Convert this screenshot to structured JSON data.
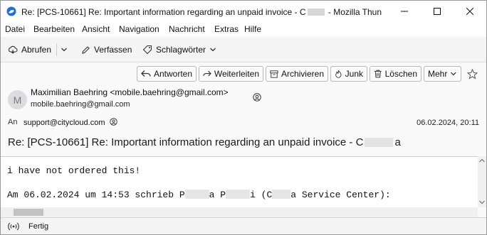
{
  "window": {
    "title_prefix": "Re: [PCS-10661] Re: Important information regarding an unpaid invoice - C",
    "title_suffix": " - Mozilla Thun"
  },
  "menubar": {
    "items": [
      "Datei",
      "Bearbeiten",
      "Ansicht",
      "Navigation",
      "Nachricht",
      "Extras",
      "Hilfe"
    ]
  },
  "toolbar": {
    "get_messages": "Abrufen",
    "compose": "Verfassen",
    "tags": "Schlagwörter"
  },
  "header_actions": {
    "reply": "Antworten",
    "forward": "Weiterleiten",
    "archive": "Archivieren",
    "junk": "Junk",
    "delete": "Löschen",
    "more": "Mehr"
  },
  "message": {
    "avatar_initial": "M",
    "from": "Maximilian Baehring <mobile.baehring@gmail.com>",
    "from_address": "mobile.baehring@gmail.com",
    "to_label": "An",
    "to": "support@citycloud.com",
    "date": "06.02.2024, 20:11",
    "subject_prefix": "Re: [PCS-10661] Re: Important information regarding an unpaid invoice - C",
    "subject_suffix": "a"
  },
  "body": {
    "line1": "i have not ordered this!",
    "line2_a": "Am 06.02.2024 um 14:53 schrieb P",
    "line2_b": "a P",
    "line2_c": "i (C",
    "line2_d": "a Service Center):"
  },
  "status": {
    "text": "Fertig"
  }
}
